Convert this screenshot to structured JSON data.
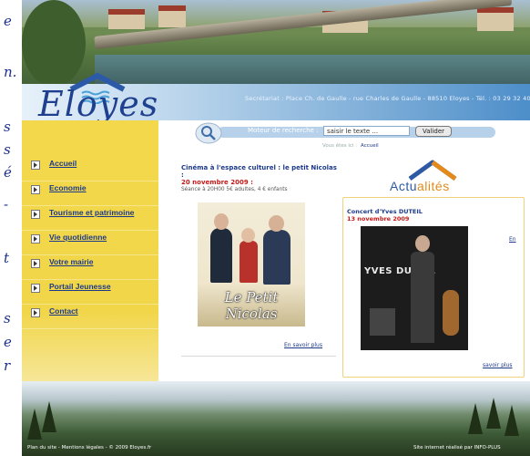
{
  "left_fragments": [
    "e",
    "n.",
    "s",
    "s",
    "é",
    "-",
    "t",
    "s",
    "e",
    "r"
  ],
  "header": {
    "contact_line": "Secrétariat : Place Ch. de Gaulle - rue Charles de Gaulle - 88510 Eloyes - Tél. : 03 29 32 40 18",
    "logo_text": "Eloyes"
  },
  "sidebar": {
    "items": [
      {
        "label": "Accueil"
      },
      {
        "label": "Economie"
      },
      {
        "label": "Tourisme et patrimoine"
      },
      {
        "label": "Vie quotidienne"
      },
      {
        "label": "Votre mairie"
      },
      {
        "label": "Portail Jeunesse"
      },
      {
        "label": "Contact"
      }
    ]
  },
  "search": {
    "label": "Moteur de recherche :",
    "placeholder": "saisir le texte ...",
    "button": "Valider"
  },
  "breadcrumb": {
    "prefix": "Vous êtes ici :",
    "current": "Accueil"
  },
  "news": {
    "title": "Cinéma à l'espace culturel : le petit Nicolas :",
    "date": "20 novembre 2009 :",
    "desc": "Séance à 20H00 5€ adultes, 4 € enfants",
    "poster_title": "Le Petit Nicolas",
    "more": "En savoir plus"
  },
  "actualites": {
    "logo_main": "Actu",
    "logo_accent": "alités",
    "title": "Concert d'Yves DUTEIL",
    "date": "13 novembre 2009",
    "en_link": "En",
    "photo_name": "YVES DUTEIL",
    "more": "savoir plus"
  },
  "footer": {
    "left": "Plan du site - Mentions légales - © 2009 Eloyes.fr",
    "right": "Site internet réalisé par INFO-PLUS"
  },
  "colors": {
    "brand_blue": "#1d3a8a",
    "accent_red": "#c51a1a",
    "sidebar_yellow": "#f1d64a",
    "accent_orange": "#e48a1a"
  }
}
